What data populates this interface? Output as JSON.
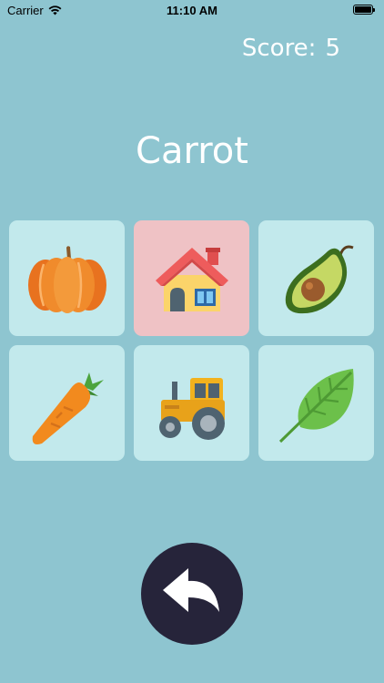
{
  "status_bar": {
    "carrier": "Carrier",
    "time": "11:10 AM",
    "battery_level": 1.0
  },
  "score": {
    "label": "Score:",
    "value": "5"
  },
  "target_word": "Carrot",
  "tiles": [
    {
      "icon": "pumpkin-icon",
      "state": "neutral"
    },
    {
      "icon": "house-icon",
      "state": "wrong"
    },
    {
      "icon": "avocado-icon",
      "state": "neutral"
    },
    {
      "icon": "carrot-icon",
      "state": "neutral"
    },
    {
      "icon": "tractor-icon",
      "state": "neutral"
    },
    {
      "icon": "leaf-icon",
      "state": "neutral"
    }
  ],
  "colors": {
    "background": "#8ec5d0",
    "tile": "#c2e9ec",
    "tile_wrong": "#efc2c5",
    "back_button": "#26243a"
  },
  "back_button_icon": "back-arrow-icon"
}
